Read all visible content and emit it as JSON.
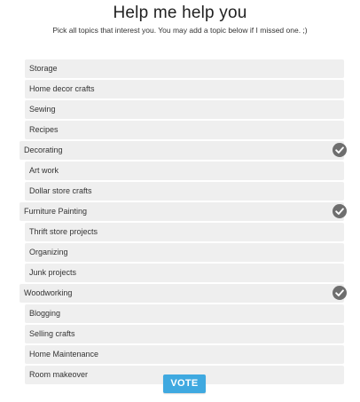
{
  "poll": {
    "title": "Help me help you",
    "instructions": "Pick all topics that interest you.  You may add a topic below if I missed one.  ;)",
    "vote_label": "VOTE",
    "accent_color": "#3fa9e0",
    "check_color": "#6e6e6e"
  },
  "topics": [
    {
      "label": "Storage",
      "selected": false
    },
    {
      "label": "Home decor crafts",
      "selected": false
    },
    {
      "label": "Sewing",
      "selected": false
    },
    {
      "label": "Recipes",
      "selected": false
    },
    {
      "label": "Decorating",
      "selected": true,
      "icon": "check-circle-icon"
    },
    {
      "label": "Art work",
      "selected": false
    },
    {
      "label": "Dollar store crafts",
      "selected": false
    },
    {
      "label": "Furniture Painting",
      "selected": true,
      "icon": "check-circle-icon"
    },
    {
      "label": "Thrift store projects",
      "selected": false
    },
    {
      "label": "Organizing",
      "selected": false
    },
    {
      "label": "Junk projects",
      "selected": false
    },
    {
      "label": "Woodworking",
      "selected": true,
      "icon": "check-circle-icon"
    },
    {
      "label": "Blogging",
      "selected": false
    },
    {
      "label": "Selling crafts",
      "selected": false
    },
    {
      "label": "Home Maintenance",
      "selected": false
    },
    {
      "label": "Room makeover",
      "selected": false
    }
  ]
}
